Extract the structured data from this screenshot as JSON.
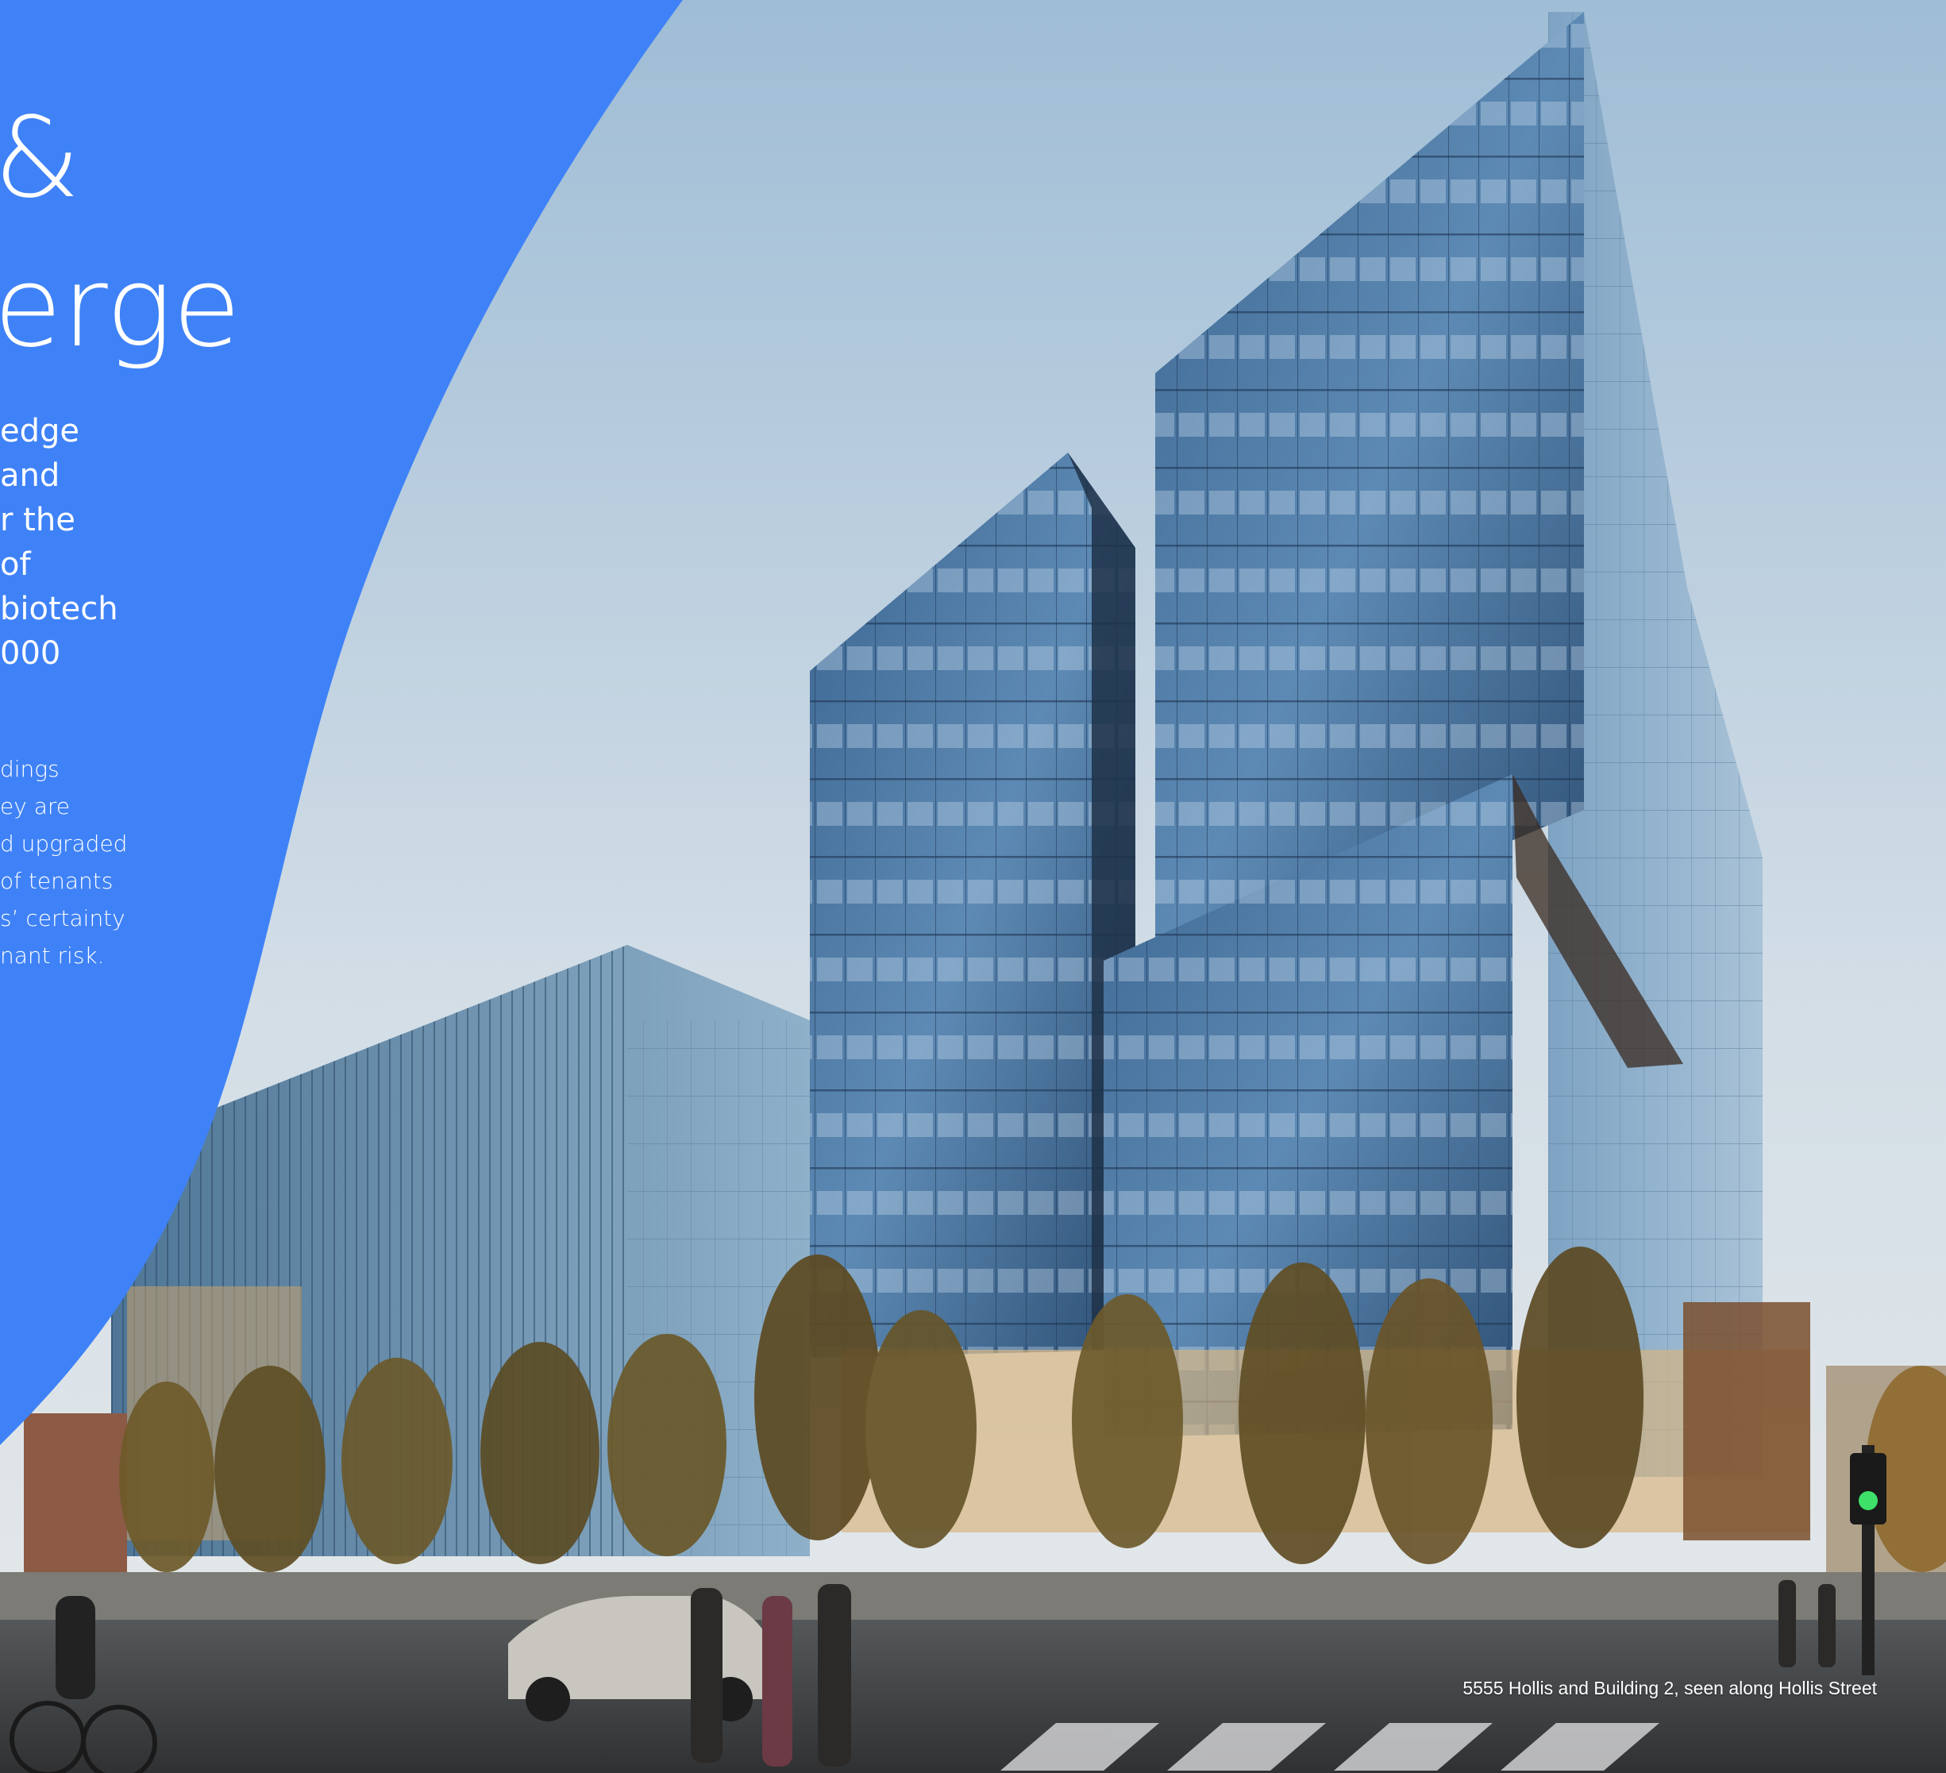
{
  "colors": {
    "accent_blue": "#3f82f7",
    "sky_top": "#a9c4da",
    "sky_bottom": "#dfe6eb",
    "glass_dark": "#2f4d6e",
    "glass_light": "#7fa7c9",
    "street": "#3a3d40"
  },
  "panel": {
    "heading_lines": [
      "&",
      "erge"
    ],
    "lead_lines": [
      "edge",
      " and",
      "r the",
      "of",
      " biotech",
      "000"
    ],
    "body_lines": [
      "dings",
      "ey are",
      "d upgraded",
      "of tenants",
      "s’ certainty",
      "nant risk."
    ]
  },
  "photo": {
    "caption": "5555 Hollis and Building 2, seen along Hollis Street"
  }
}
